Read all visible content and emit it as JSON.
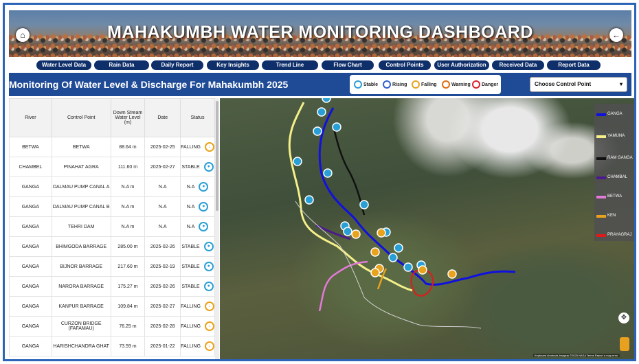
{
  "header": {
    "title": "MAHAKUMBH WATER MONITORING DASHBOARD",
    "home_icon": "⌂",
    "back_icon": "←"
  },
  "nav": [
    {
      "label": "Water Level Data"
    },
    {
      "label": "Rain Data"
    },
    {
      "label": "Daily Report"
    },
    {
      "label": "Key Insights"
    },
    {
      "label": "Trend Line"
    },
    {
      "label": "Flow Chart"
    },
    {
      "label": "Control Points"
    },
    {
      "label": "User Authorization"
    },
    {
      "label": "Received Data"
    },
    {
      "label": "Report Data"
    }
  ],
  "subheader": {
    "title": "Monitoring Of Water Level & Discharge For Mahakumbh 2025",
    "legend": [
      {
        "label": "Stable",
        "color": "#2a9fd6"
      },
      {
        "label": "Rising",
        "color": "#2f5fd0"
      },
      {
        "label": "Falling",
        "color": "#e9a21b"
      },
      {
        "label": "Warning",
        "color": "#e06a10"
      },
      {
        "label": "Danger",
        "color": "#d8202a"
      }
    ],
    "select_label": "Choose Control Point"
  },
  "table": {
    "headers": [
      "River",
      "Control Point",
      "Down Stream Water Level (m)",
      "Date",
      "Status"
    ],
    "rows": [
      {
        "river": "BETWA",
        "cp": "BETWA",
        "level": "88.64 m",
        "date": "2025-02-25",
        "status": "FALLING"
      },
      {
        "river": "CHAMBEL",
        "cp": "PINAHAT AGRA",
        "level": "111.60 m",
        "date": "2025-02-27",
        "status": "STABLE"
      },
      {
        "river": "GANGA",
        "cp": "DALMAU PUMP CANAL A",
        "level": "N.A m",
        "date": "N.A",
        "status": "N.A"
      },
      {
        "river": "GANGA",
        "cp": "DALMAU PUMP CANAL B",
        "level": "N.A m",
        "date": "N.A",
        "status": "N.A"
      },
      {
        "river": "GANGA",
        "cp": "TEHRI DAM",
        "level": "N.A m",
        "date": "N.A",
        "status": "N.A"
      },
      {
        "river": "GANGA",
        "cp": "BHIMGODA BARRAGE",
        "level": "285.00 m",
        "date": "2025-02-26",
        "status": "STABLE"
      },
      {
        "river": "GANGA",
        "cp": "BIJNOR BARRAGE",
        "level": "217.60 m",
        "date": "2025-02-19",
        "status": "STABLE"
      },
      {
        "river": "GANGA",
        "cp": "NARORA BARRAGE",
        "level": "175.27 m",
        "date": "2025-02-26",
        "status": "STABLE"
      },
      {
        "river": "GANGA",
        "cp": "KANPUR BARRAGE",
        "level": "109.84 m",
        "date": "2025-02-27",
        "status": "FALLING"
      },
      {
        "river": "GANGA",
        "cp": "CURZON BRIDGE (FAFAMAU)",
        "level": "76.25 m",
        "date": "2025-02-28",
        "status": "FALLING"
      },
      {
        "river": "GANGA",
        "cp": "HARISHCHANDRA GHAT",
        "level": "73.59 m",
        "date": "2025-01-22",
        "status": "FALLING"
      }
    ]
  },
  "map_legend": [
    {
      "label": "GANGA",
      "color": "#1010e0"
    },
    {
      "label": "YAMUNA",
      "color": "#f4ef8a"
    },
    {
      "label": "RAM GANGA",
      "color": "#111111"
    },
    {
      "label": "CHAMBAL",
      "color": "#4b1a8c"
    },
    {
      "label": "BETWA",
      "color": "#e27ad8"
    },
    {
      "label": "KEN",
      "color": "#e9a21b"
    },
    {
      "label": "PRAYAGRAJ",
      "color": "#e01a1a"
    }
  ],
  "map": {
    "attribution": "Keyboard shortcuts   Imagery ©2025 NASA   Terms   Report a map error"
  }
}
